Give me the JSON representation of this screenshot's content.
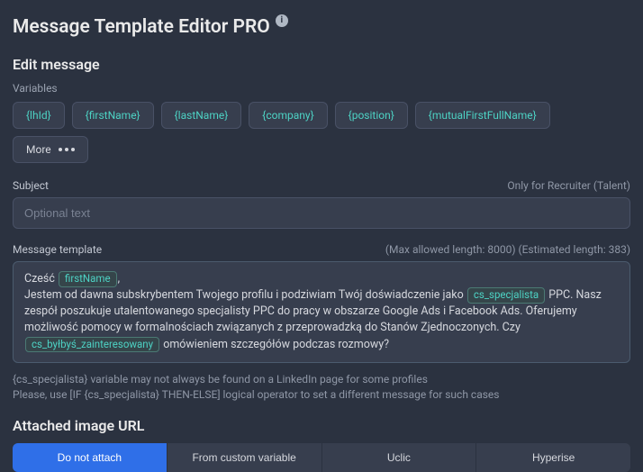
{
  "header": {
    "title": "Message Template Editor PRO"
  },
  "edit": {
    "heading": "Edit message",
    "variables_label": "Variables",
    "more_label": "More"
  },
  "chips": {
    "items": [
      "{lhId}",
      "{firstName}",
      "{lastName}",
      "{company}",
      "{position}",
      "{mutualFirstFullName}"
    ]
  },
  "subject": {
    "label": "Subject",
    "aside": "Only for Recruiter (Talent)",
    "placeholder": "Optional text",
    "value": ""
  },
  "template": {
    "label": "Message template",
    "aside": "(Max allowed length: 8000) (Estimated length: 383)",
    "fragments": {
      "greeting_prefix": "Cześć ",
      "greeting_var": "firstName",
      "greeting_suffix": ",",
      "body1": "Jestem od dawna subskrybentem Twojego profilu i podziwiam Twój doświadczenie jako ",
      "var2": "cs_specjalista",
      "body2": " PPC. Nasz zespół poszukuje utalentowanego specjalisty PPC do pracy w obszarze Google Ads i Facebook Ads. Oferujemy możliwość pomocy w formalnościach związanych z przeprowadzką do Stanów Zjednoczonych. Czy ",
      "var3": "cs_byłbyś_zainteresowany",
      "body3": " omówieniem szczegółów podczas rozmowy?"
    }
  },
  "warning": {
    "line1": "{cs_specjalista} variable may not always be found on a LinkedIn page for some profiles",
    "line2": "Please, use [IF {cs_specjalista} THEN-ELSE] logical operator to set a different message for such cases"
  },
  "attach": {
    "heading": "Attached image URL",
    "options": {
      "do_not": "Do not attach",
      "custom": "From custom variable",
      "uclic": "Uclic",
      "hyperise": "Hyperise"
    }
  }
}
